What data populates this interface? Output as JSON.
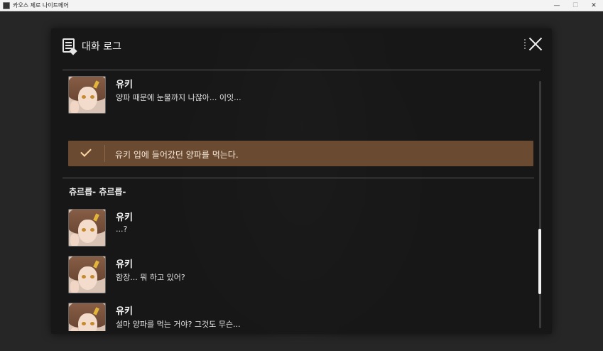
{
  "window": {
    "title": "카오스 제로 나이트메어",
    "controls": {
      "minimize": "—",
      "maximize": "☐",
      "close": "✕"
    }
  },
  "panel": {
    "title": "대화 로그",
    "icons": {
      "log": "dialog-log-icon",
      "close": "close-icon"
    }
  },
  "log": {
    "entry1": {
      "speaker": "유키",
      "text": "양파 때문에 눈물까지 나잖아... 이잇..."
    },
    "choice": {
      "text": "유키 입에 들어갔던 양파를 먹는다.",
      "icon": "check-icon"
    },
    "narration": "츄르릅- 츄르릅-",
    "entry2": {
      "speaker": "유키",
      "text": "...?"
    },
    "entry3": {
      "speaker": "유키",
      "text": "함장... 뭐 하고 있어?"
    },
    "entry4": {
      "speaker": "유키",
      "text": "설마 양파를 먹는 거야? 그것도 무슨..."
    }
  },
  "colors": {
    "choice_bg": "#6b4a32",
    "panel_bg": "#161616",
    "accent": "#ffd6a3"
  }
}
